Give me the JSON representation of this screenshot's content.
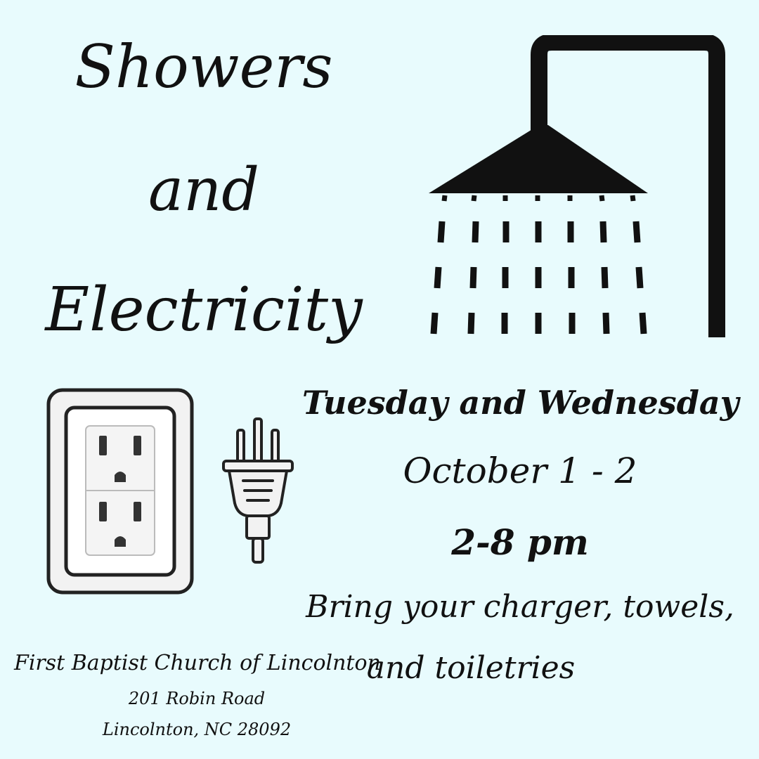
{
  "title": {
    "line1": "Showers",
    "line2": "and",
    "line3": "Electricity"
  },
  "event": {
    "days": "Tuesday and Wednesday",
    "dates": "October 1 - 2",
    "time": "2-8 pm",
    "bring_line1": "Bring your charger, towels,",
    "bring_line2": "and toiletries"
  },
  "location": {
    "name": "First Baptist Church of Lincolnton",
    "street": "201 Robin Road",
    "city": "Lincolnton, NC 28092"
  },
  "icons": {
    "shower": "shower-head-icon",
    "outlet": "electrical-outlet-icon",
    "plug": "electric-plug-icon"
  },
  "colors": {
    "background": "#e8fbfd",
    "ink": "#111111",
    "outlet_plate": "#f2f2f2",
    "outlet_inner": "#ffffff"
  }
}
